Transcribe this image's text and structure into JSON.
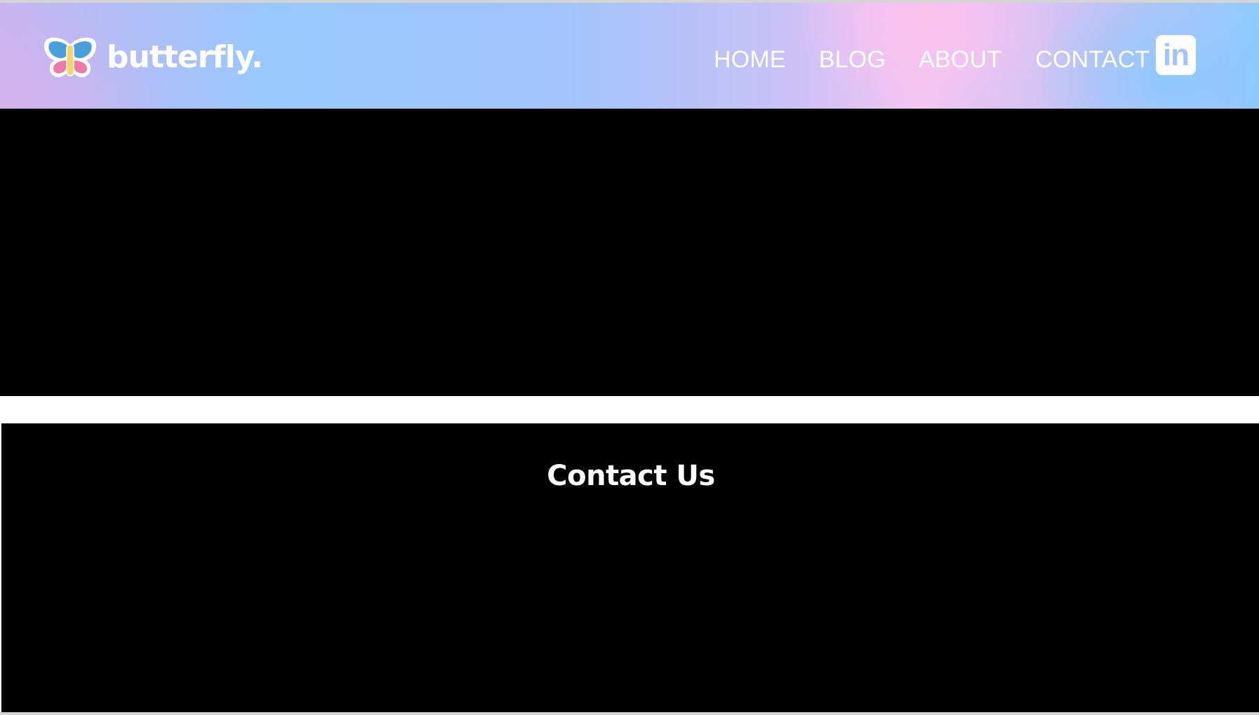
{
  "brand": {
    "name": "butterfly.",
    "logo_icon": "butterfly-icon"
  },
  "nav": {
    "items": [
      {
        "label": "HOME"
      },
      {
        "label": "BLOG"
      },
      {
        "label": "ABOUT"
      },
      {
        "label": "CONTACT"
      }
    ],
    "social": {
      "label": "in",
      "icon": "linkedin-icon"
    }
  },
  "contact": {
    "title": "Contact Us"
  },
  "colors": {
    "header_gradient": [
      "#c7b4f0",
      "#97c9fd",
      "#a2c4fb",
      "#f1c6f1",
      "#8fcbfd"
    ],
    "text": "#ffffff",
    "section_bg": "#000000",
    "logo_blue": "#4aa0dc",
    "logo_pink": "#f07aa6",
    "logo_yellow": "#f7d36b"
  }
}
